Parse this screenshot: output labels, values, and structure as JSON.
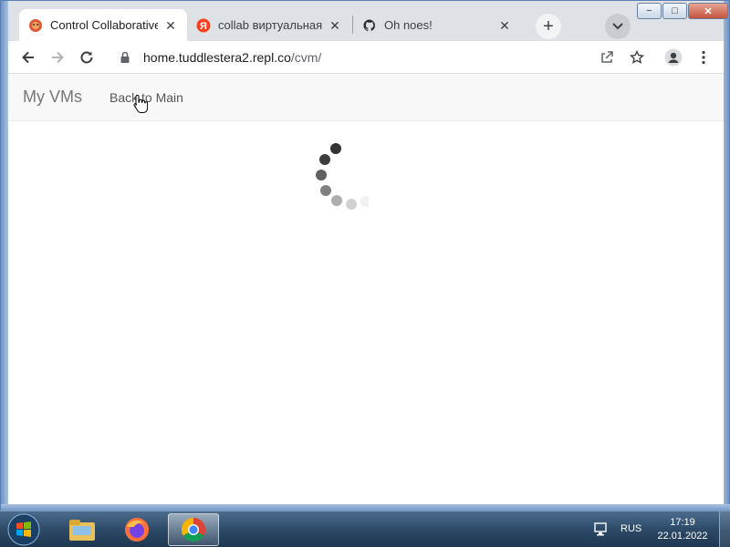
{
  "browser": {
    "tabs": [
      {
        "title": "Control Collaborative",
        "favicon": "replit-icon",
        "active": true
      },
      {
        "title": "collab виртуальная ма",
        "favicon": "yandex-icon",
        "active": false
      },
      {
        "title": "Oh noes!",
        "favicon": "github-icon",
        "active": false
      }
    ],
    "new_tab_label": "+",
    "url": {
      "host": "home.tuddlestera2.repl.co",
      "path": "/cvm/"
    },
    "window_controls": {
      "minimize": "−",
      "maximize": "□",
      "close": "✕"
    }
  },
  "page": {
    "brand": "My VMs",
    "nav_link": "Back to Main",
    "loading": true
  },
  "taskbar": {
    "apps": [
      "windows-explorer-icon",
      "firefox-icon",
      "chrome-icon"
    ],
    "language": "RUS",
    "time": "17:19",
    "date": "22.01.2022"
  },
  "colors": {
    "spinner": "#333333",
    "navbar_bg": "#f8f8f8",
    "tab_strip": "#dee1e6"
  }
}
